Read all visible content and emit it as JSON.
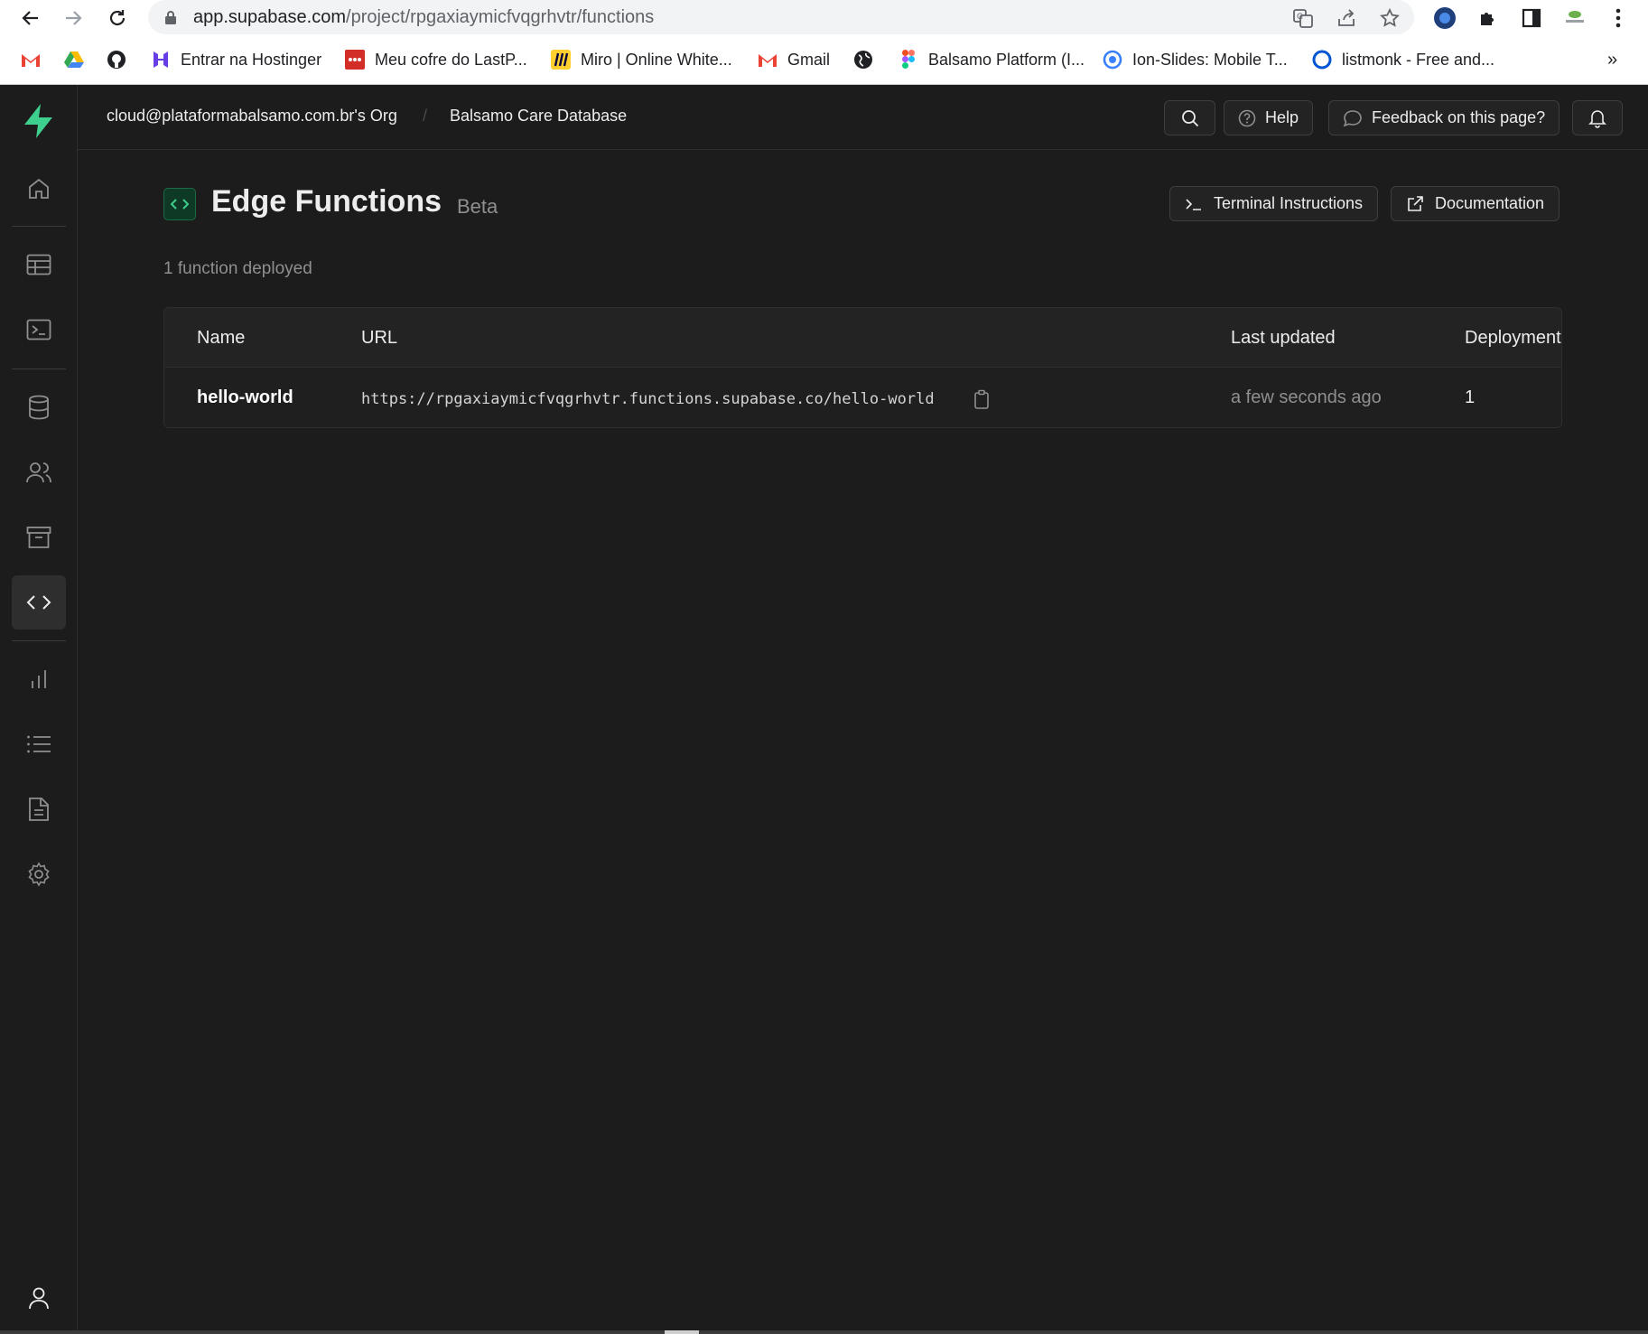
{
  "browser": {
    "url_host": "app.supabase.com",
    "url_path": "/project/rpgaxiaymicfvqgrhvtr/functions",
    "bookmarks": [
      {
        "label": "",
        "icon": "gmail-icon"
      },
      {
        "label": "",
        "icon": "google-drive-icon"
      },
      {
        "label": "",
        "icon": "github-icon"
      },
      {
        "label": "Entrar na Hostinger",
        "icon": "hostinger-icon"
      },
      {
        "label": "Meu cofre do LastP...",
        "icon": "lastpass-icon"
      },
      {
        "label": "Miro | Online White...",
        "icon": "miro-icon"
      },
      {
        "label": "Gmail",
        "icon": "gmail-icon"
      },
      {
        "label": "",
        "icon": "globe-icon"
      },
      {
        "label": "Balsamo Platform (I...",
        "icon": "figma-icon"
      },
      {
        "label": "Ion-Slides: Mobile T...",
        "icon": "ion-icon"
      },
      {
        "label": "listmonk - Free and...",
        "icon": "listmonk-icon"
      }
    ],
    "more_bookmarks": "»"
  },
  "topbar": {
    "org": "cloud@plataformabalsamo.com.br's Org",
    "separator": "/",
    "project": "Balsamo Care Database",
    "help_label": "Help",
    "feedback_label": "Feedback on this page?"
  },
  "page": {
    "title": "Edge Functions",
    "badge": "Beta",
    "terminal_label": "Terminal Instructions",
    "docs_label": "Documentation",
    "count_text": "1 function deployed"
  },
  "table": {
    "headers": [
      "Name",
      "URL",
      "Last updated",
      "Deployments"
    ],
    "rows": [
      {
        "name": "hello-world",
        "url": "https://rpgaxiaymicfvqgrhvtr.functions.supabase.co/hello-world",
        "updated": "a few seconds ago",
        "deployments": "1"
      }
    ]
  },
  "colors": {
    "brand": "#3ecf8e",
    "background": "#1c1c1c"
  }
}
